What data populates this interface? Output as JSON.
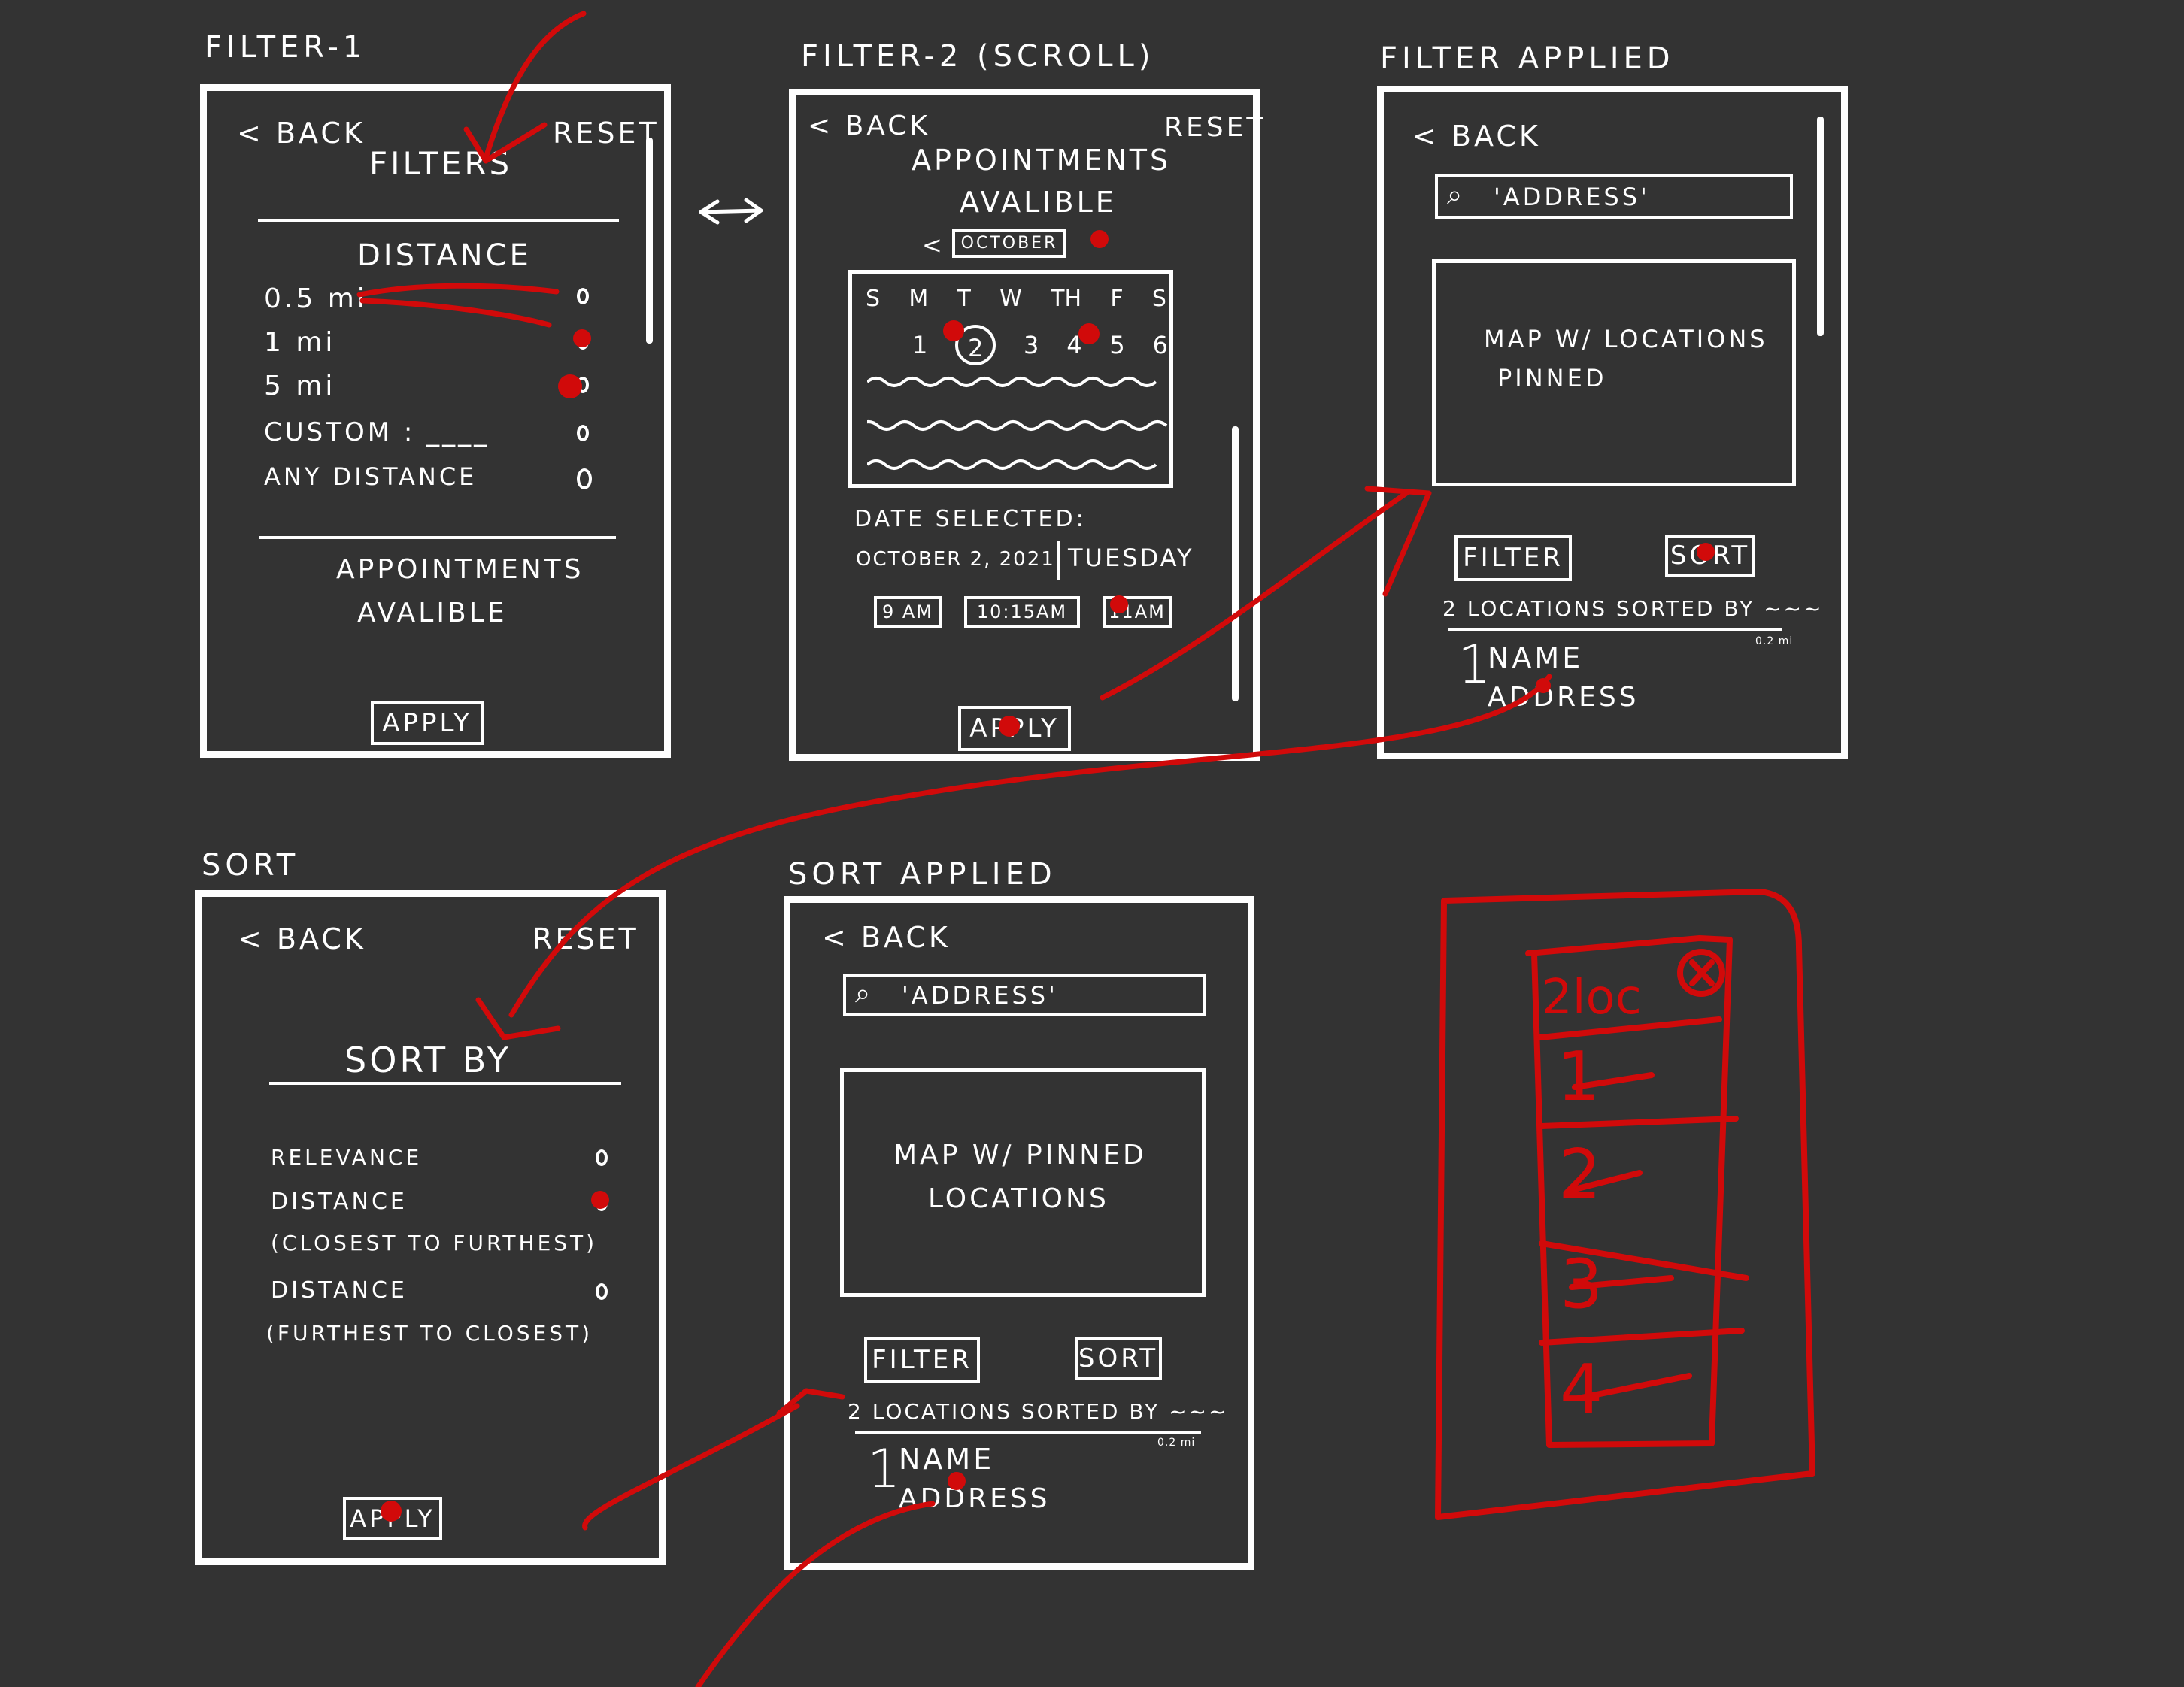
{
  "labels": {
    "filter1": "FILTER-1",
    "filter2": "FILTER-2 (SCROLL)",
    "filter_applied": "FILTER APPLIED",
    "sort": "SORT",
    "sort_applied": "SORT APPLIED"
  },
  "filter1": {
    "back": "< BACK",
    "reset": "RESET",
    "title": "FILTERS",
    "distance_heading": "DISTANCE",
    "options": [
      "0.5 mi",
      "1 mi",
      "5 mi",
      "CUSTOM : ____",
      "ANY DISTANCE"
    ],
    "appointments_line1": "APPOINTMENTS",
    "appointments_line2": "AVALIBLE",
    "apply": "APPLY"
  },
  "filter2": {
    "back": "< BACK",
    "reset": "RESET",
    "title_line1": "APPOINTMENTS",
    "title_line2": "AVALIBLE",
    "month_prev": "<",
    "month": "OCTOBER",
    "weekdays": [
      "S",
      "M",
      "T",
      "W",
      "TH",
      "F",
      "S"
    ],
    "days": [
      "1",
      "2",
      "3",
      "4",
      "5",
      "6"
    ],
    "date_selected_label": "DATE SELECTED:",
    "date_value": "OCTOBER 2, 2021",
    "day_value": "TUESDAY",
    "times": [
      "9 AM",
      "10:15AM",
      "11AM"
    ],
    "apply": "APPLY"
  },
  "filter_applied": {
    "back": "< BACK",
    "search": "'ADDRESS'",
    "map_line1": "MAP W/ LOCATIONS",
    "map_line2": "PINNED",
    "filter_btn": "FILTER",
    "sort_btn": "SORT",
    "summary": "2 LOCATIONS SORTED BY ~~~",
    "distance_tag": "0.2 mi",
    "result_index": "1",
    "result_name": "NAME",
    "result_address": "ADDRESS"
  },
  "sort": {
    "back": "< BACK",
    "reset": "RESET",
    "title": "SORT BY",
    "options": [
      "RELEVANCE",
      "DISTANCE",
      "(CLOSEST TO FURTHEST)",
      "DISTANCE",
      "(FURTHEST TO CLOSEST)"
    ],
    "apply": "APPLY"
  },
  "sort_applied": {
    "back": "< BACK",
    "search": "'ADDRESS'",
    "map_line1": "MAP W/ PINNED",
    "map_line2": "LOCATIONS",
    "filter_btn": "FILTER",
    "sort_btn": "SORT",
    "summary": "2 LOCATIONS SORTED BY ~~~",
    "distance_tag": "0.2 mi",
    "result_index": "1",
    "result_name": "NAME",
    "result_address": "ADDRESS"
  },
  "red_sketch": {
    "header": "2loc",
    "items": [
      "1",
      "2",
      "3",
      "4"
    ]
  },
  "colors": {
    "background": "#333333",
    "ink": "#ffffff",
    "annotation": "#d10a0a"
  }
}
